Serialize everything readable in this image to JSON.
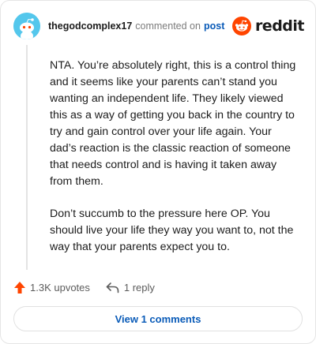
{
  "header": {
    "username": "thegodcomplex17",
    "action_text": "commented on",
    "post_link": "post",
    "brand_name": "reddit"
  },
  "comment": {
    "paragraphs": [
      "NTA. You’re absolutely right, this is a control thing and it seems like your parents can’t stand you wanting an independent life. They likely viewed this as a way of getting you back in the country to try and gain control over your life again. Your dad’s reaction is the classic reaction of someone that needs control and is having it taken away from them.",
      "Don’t succumb to the pressure here OP. You should live your life they way you want to, not the way that your parents expect you to."
    ]
  },
  "actions": {
    "upvotes": "1.3K upvotes",
    "replies": "1 reply"
  },
  "view_button": "View 1 comments",
  "colors": {
    "brand": "#ff4500",
    "link": "#0a5bb8",
    "avatar_bg": "#54c7ec",
    "upvote": "#ff4500"
  },
  "icons": {
    "avatar": "snoo-avatar-icon",
    "brand": "reddit-logo-icon",
    "upvote": "upvote-arrow-icon",
    "reply": "reply-arrow-icon"
  }
}
